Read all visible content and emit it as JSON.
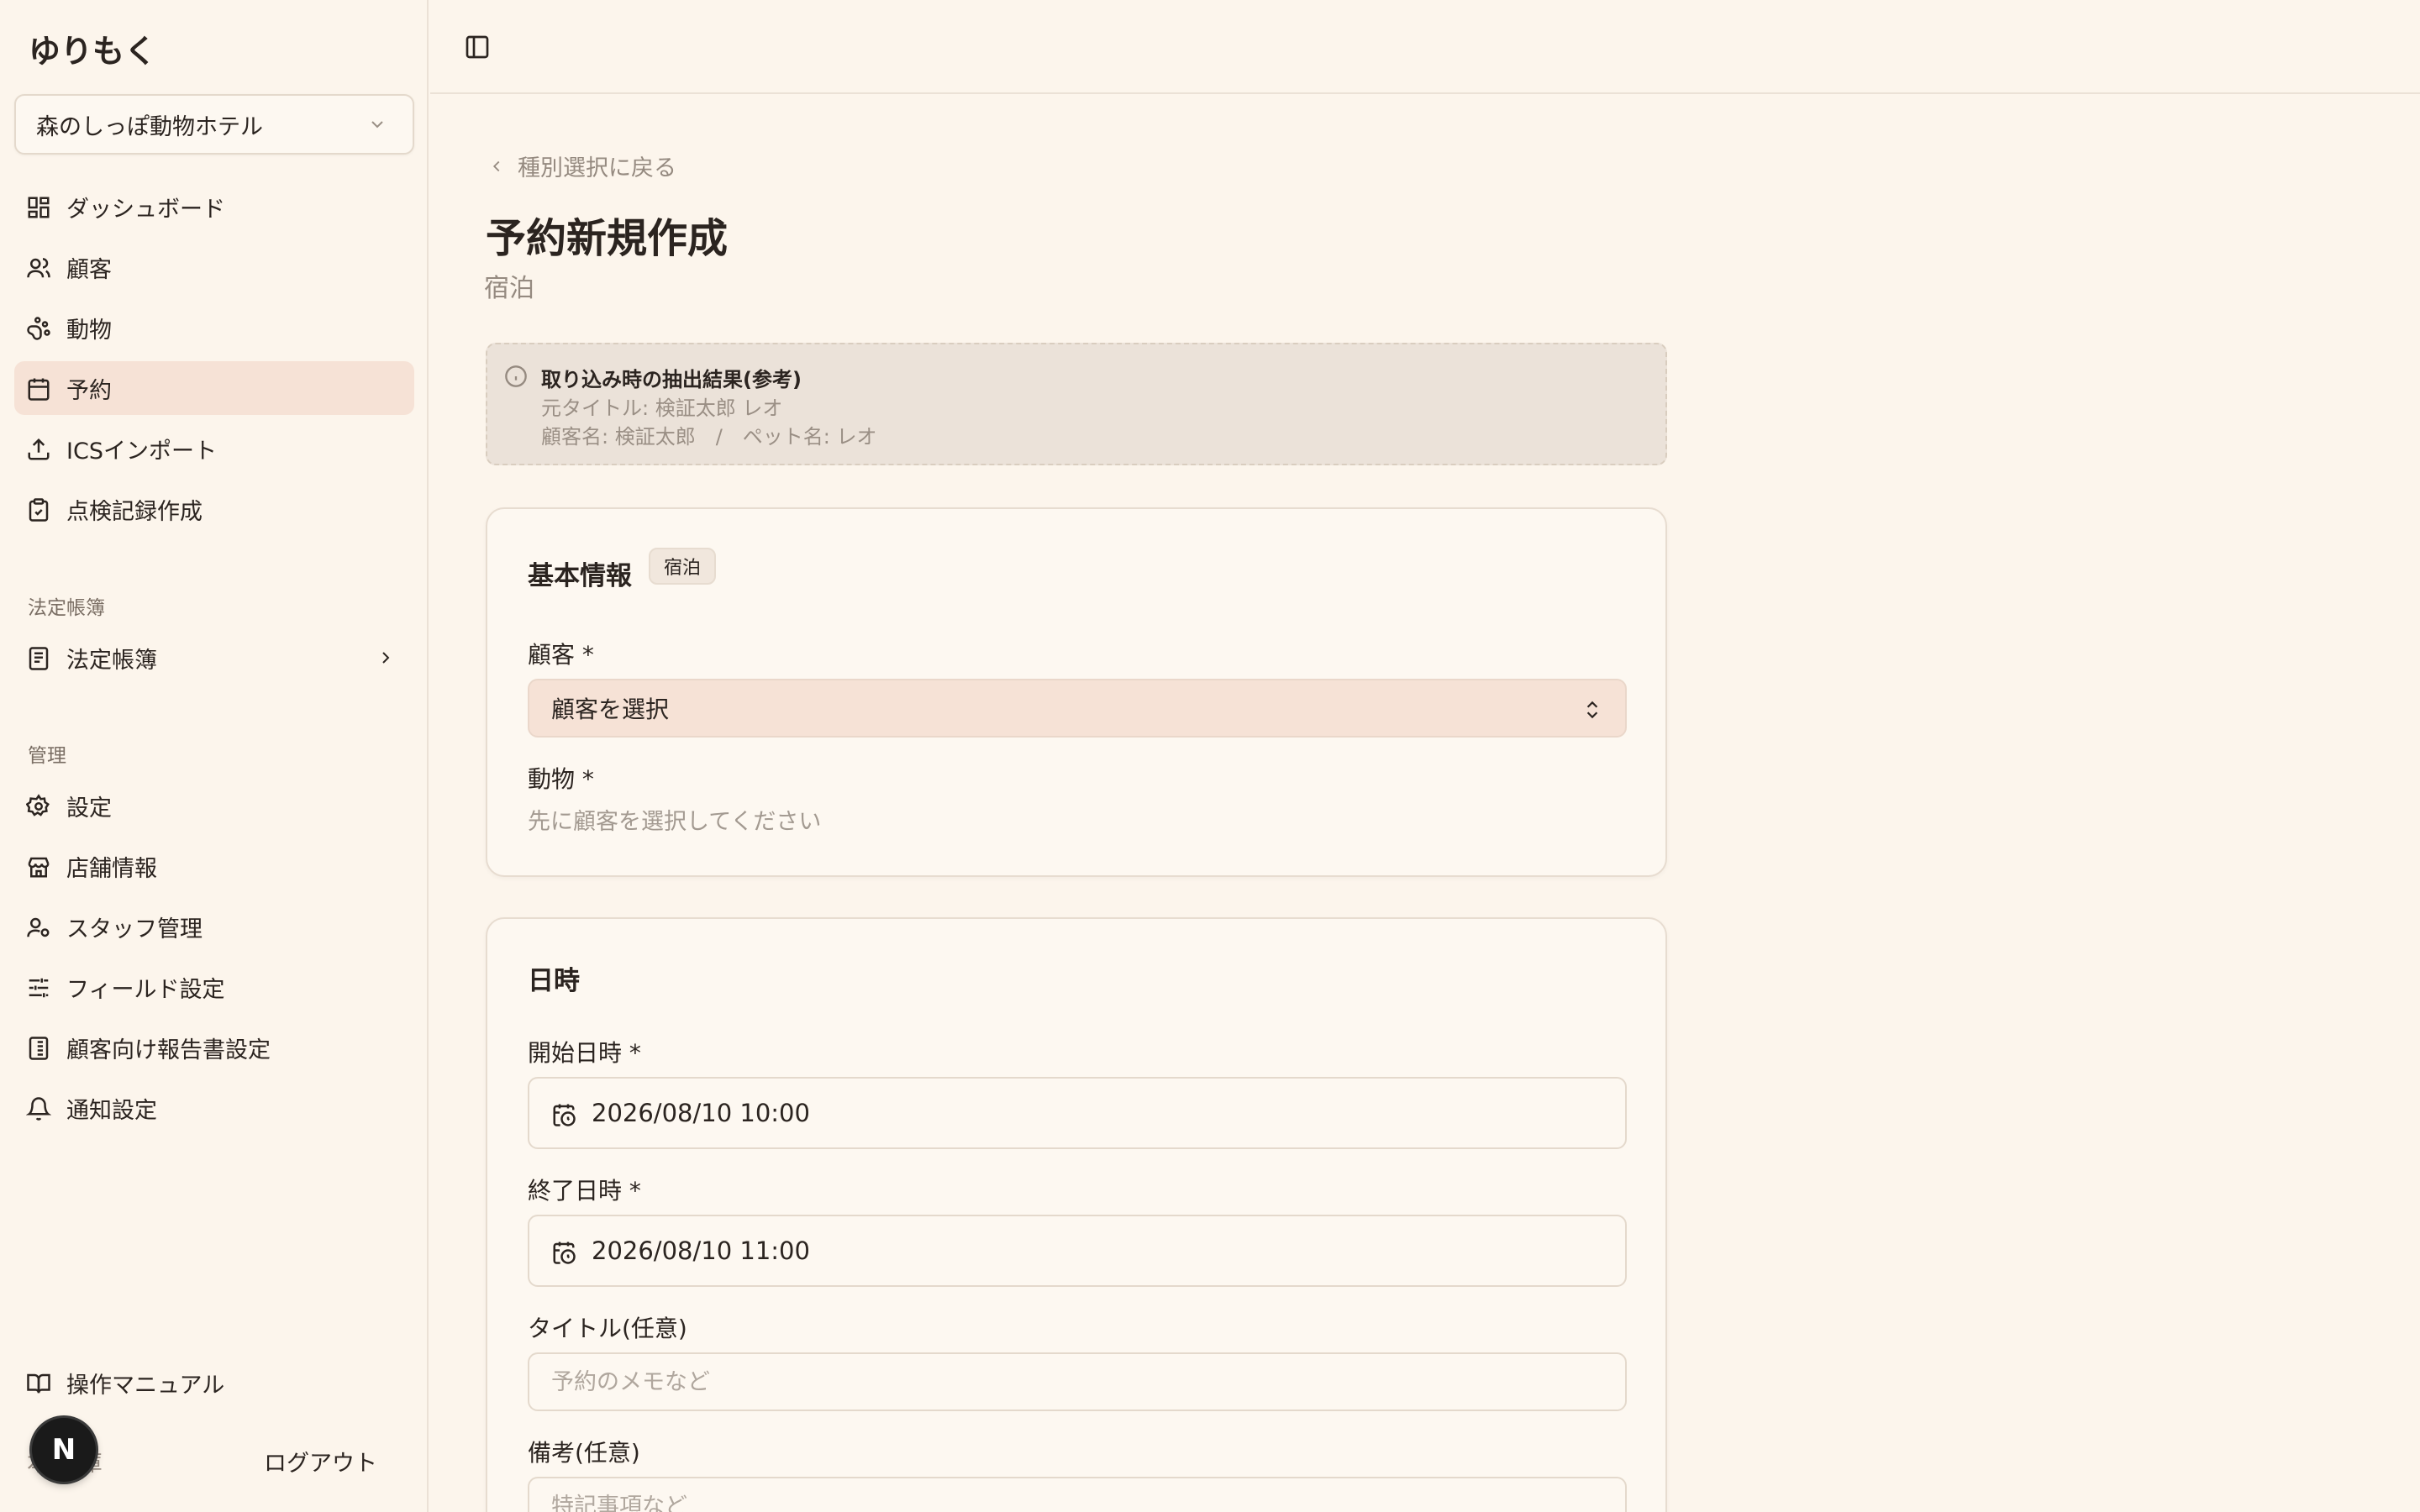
{
  "app": {
    "brand": "ゆりもく"
  },
  "store_selector": {
    "value": "森のしっぽ動物ホテル"
  },
  "nav": {
    "main": [
      {
        "label": "ダッシュボード",
        "icon": "dashboard-icon"
      },
      {
        "label": "顧客",
        "icon": "users-icon"
      },
      {
        "label": "動物",
        "icon": "paw-icon"
      },
      {
        "label": "予約",
        "icon": "calendar-icon",
        "active": true
      },
      {
        "label": "ICSインポート",
        "icon": "upload-icon"
      },
      {
        "label": "点検記録作成",
        "icon": "clipboard-icon"
      }
    ],
    "ledger_section": "法定帳簿",
    "ledger_item": "法定帳簿",
    "admin_section": "管理",
    "admin": [
      {
        "label": "設定",
        "icon": "gear-icon"
      },
      {
        "label": "店舗情報",
        "icon": "store-icon"
      },
      {
        "label": "スタッフ管理",
        "icon": "staff-icon"
      },
      {
        "label": "フィールド設定",
        "icon": "sliders-icon"
      },
      {
        "label": "顧客向け報告書設定",
        "icon": "report-icon"
      },
      {
        "label": "通知設定",
        "icon": "bell-icon"
      }
    ],
    "manual": "操作マニュアル",
    "user_partial": "本店 庫",
    "logout": "ログアウト",
    "badge_letter": "N"
  },
  "page": {
    "back_link": "種別選択に戻る",
    "title": "予約新規作成",
    "subtitle": "宿泊"
  },
  "extract": {
    "title": "取り込み時の抽出結果(参考)",
    "line1": "元タイトル: 検証太郎 レオ",
    "line2": "顧客名: 検証太郎　/　ペット名: レオ"
  },
  "basic": {
    "title": "基本情報",
    "chip": "宿泊",
    "customer_label": "顧客 *",
    "customer_value": "顧客を選択",
    "animal_label": "動物 *",
    "animal_hint": "先に顧客を選択してください"
  },
  "datetime": {
    "title": "日時",
    "start_label": "開始日時 *",
    "start_value": "2026/08/10 10:00",
    "end_label": "終了日時 *",
    "end_value": "2026/08/10 11:00",
    "title_label": "タイトル(任意)",
    "title_placeholder": "予約のメモなど",
    "note_label": "備考(任意)",
    "note_placeholder": "特記事項など"
  },
  "colors": {
    "background": "#fcf5ec",
    "active": "#f6e2d6",
    "text": "#2b2420",
    "muted": "#958a80"
  }
}
